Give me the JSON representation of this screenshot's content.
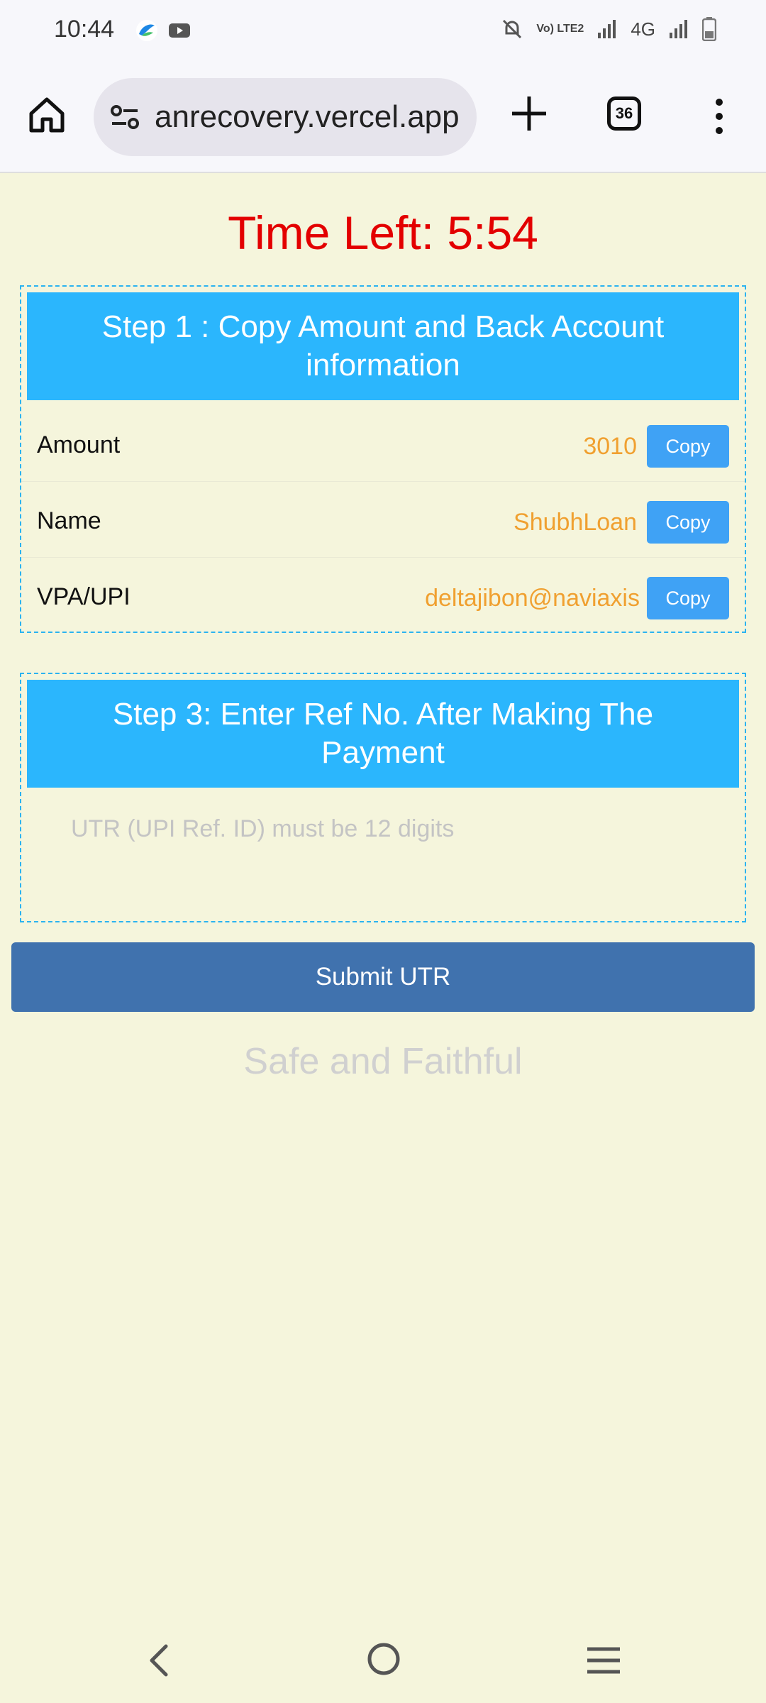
{
  "status_bar": {
    "time": "10:44",
    "network": "4G",
    "volte": "Vo) LTE2",
    "icons": [
      "vpn-bird-icon",
      "youtube-icon",
      "mute-icon",
      "signal-icon",
      "battery-icon"
    ]
  },
  "browser": {
    "url": "anrecovery.vercel.app",
    "tab_count": "36",
    "icons": [
      "home-icon",
      "site-settings-icon",
      "plus-icon",
      "tabs-icon",
      "more-icon"
    ]
  },
  "page": {
    "timer": "Time Left: 5:54",
    "step1": {
      "title": "Step 1 : Copy Amount and Back Account information",
      "rows": [
        {
          "label": "Amount",
          "value": "3010",
          "button": "Copy"
        },
        {
          "label": "Name",
          "value": "ShubhLoan",
          "button": "Copy"
        },
        {
          "label": "VPA/UPI",
          "value": "deltajibon@naviaxis",
          "button": "Copy"
        }
      ]
    },
    "step3": {
      "title": "Step 3: Enter Ref No. After Making The Payment",
      "utr_placeholder": "UTR (UPI Ref. ID) must be 12 digits",
      "utr_value": ""
    },
    "submit_label": "Submit UTR",
    "footer": "Safe and Faithful"
  },
  "colors": {
    "background": "#f5f5dc",
    "timer": "#e30000",
    "header": "#2bb6fd",
    "value": "#f0a030",
    "copy_button": "#3fa2f5",
    "submit_button": "#4072ae"
  }
}
